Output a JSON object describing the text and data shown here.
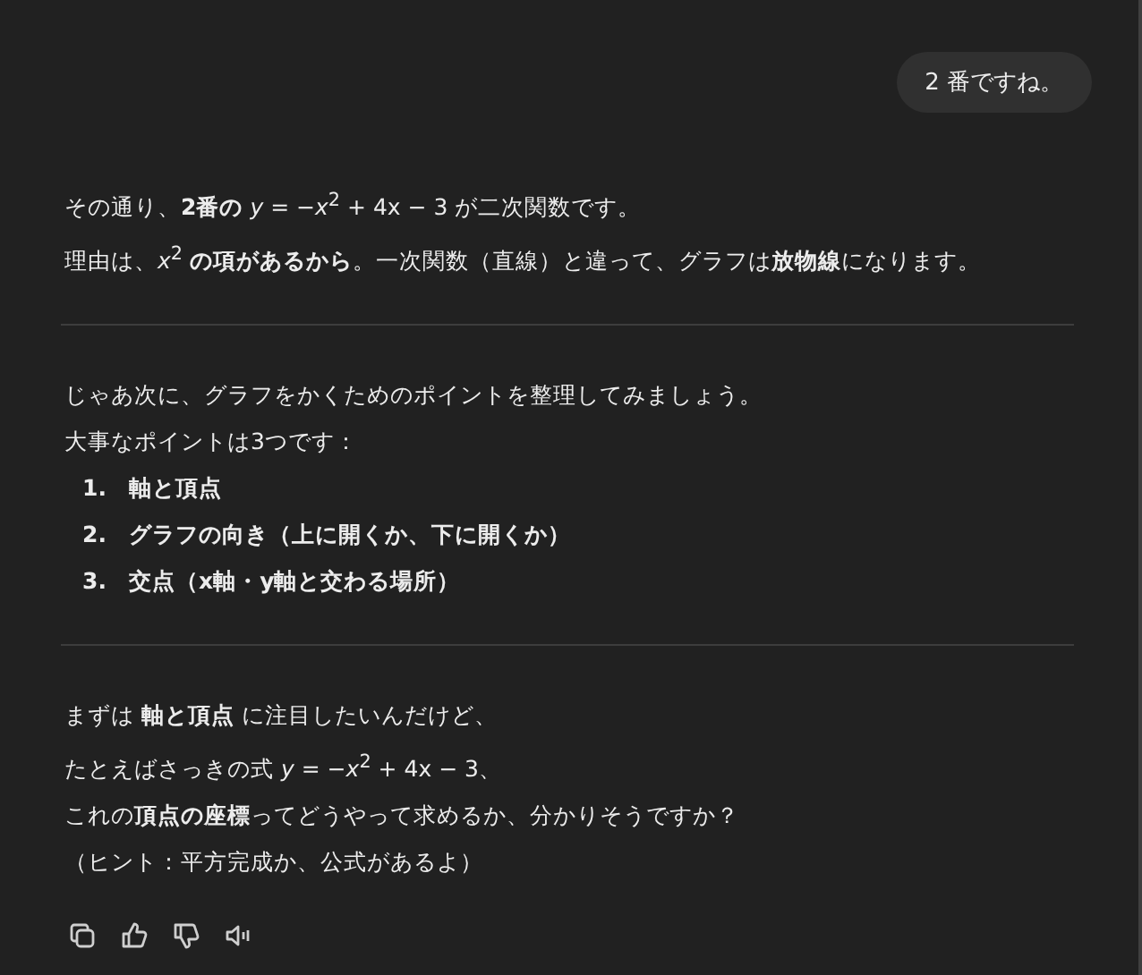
{
  "user_message": "2 番ですね。",
  "paragraphs_1": [
    "その通り、**2番の** *y* = −*x*$^{2}$ + 4x − 3 が二次関数です。",
    "理由は、*x*$^{2}$ **の項があるから**。一次関数（直線）と違って、グラフは**放物線**になります。"
  ],
  "paragraphs_2": [
    "じゃあ次に、グラフをかくためのポイントを整理してみましょう。",
    "大事なポイントは3つです："
  ],
  "points": [
    {
      "number": "1.",
      "text": "軸と頂点"
    },
    {
      "number": "2.",
      "text": "グラフの向き（上に開くか、下に開くか）"
    },
    {
      "number": "3.",
      "text": "交点（x軸・y軸と交わる場所）"
    }
  ],
  "paragraphs_3": [
    "まずは **軸と頂点** に注目したいんだけど、",
    "たとえばさっきの式 *y* = −*x*$^{2}$ + 4x − 3、",
    "これの**頂点の座標**ってどうやって求めるか、分かりそうですか？",
    "（ヒント：平方完成か、公式があるよ）"
  ],
  "actions": [
    {
      "kind": "copy"
    },
    {
      "kind": "like"
    },
    {
      "kind": "dislike"
    },
    {
      "kind": "speak"
    }
  ]
}
